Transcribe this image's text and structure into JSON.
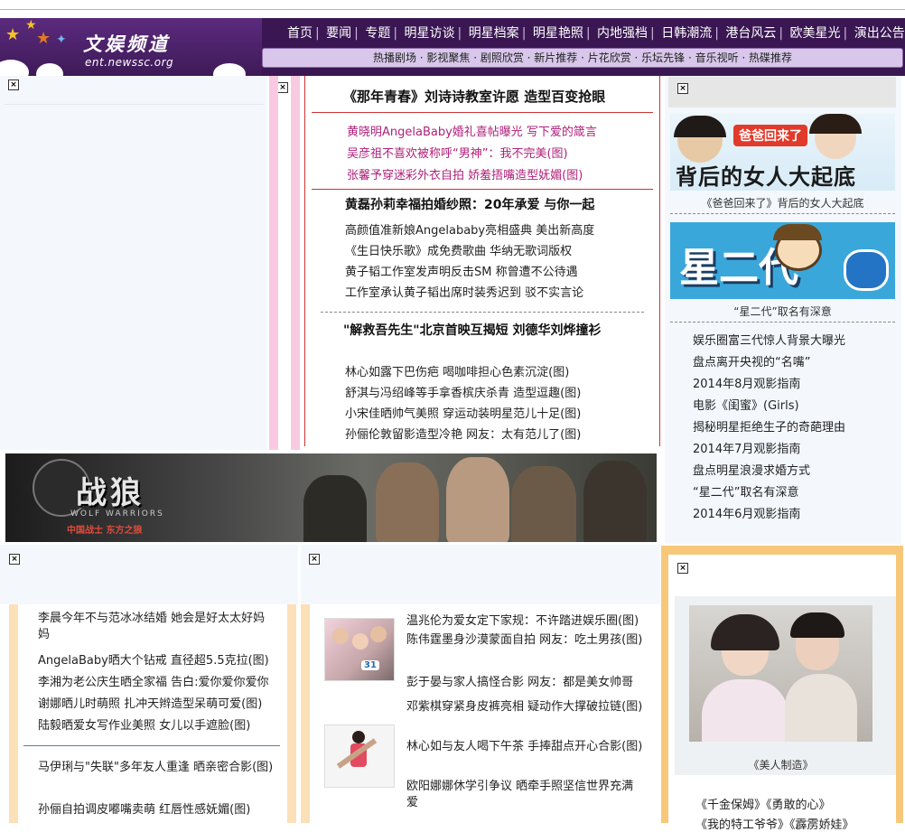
{
  "header": {
    "logo_title": "文娱频道",
    "logo_url": "ent.newssc.org",
    "nav_main": [
      "首页",
      "要闻",
      "专题",
      "明星访谈",
      "明星档案",
      "明星艳照",
      "内地强档",
      "日韩潮流",
      "港台风云",
      "欧美星光",
      "演出公告"
    ],
    "nav_sub": "热播剧场 · 影视聚焦 · 剧照欣赏 · 新片推荐 · 片花欣赏 · 乐坛先锋 · 音乐视听 · 热碟推荐"
  },
  "center": {
    "headline1": "《那年青春》刘诗诗教室许愿 造型百变抢眼",
    "pink_links": [
      "黄晓明AngelaBaby婚礼喜帖曝光 写下爱的箴言",
      "吴彦祖不喜欢被称呼“男神”：我不完美(图)",
      "张馨予穿迷彩外衣自拍 娇羞捂嘴造型妩媚(图)"
    ],
    "headline2": "黄磊孙莉幸福拍婚纱照：20年承爱 与你一起",
    "links2": [
      "高颜值准新娘Angelababy亮相盛典 美出新高度",
      "《生日快乐歌》成免费歌曲 华纳无歌词版权",
      "黄子韬工作室发声明反击SM 称曾遭不公待遇",
      "工作室承认黄子韬出席时装秀迟到 驳不实言论"
    ],
    "headline3": "\"解救吾先生\"北京首映互揭短 刘德华刘烨撞衫",
    "links3": [
      "林心如露下巴伤疤 喝咖啡担心色素沉淀(图)",
      "舒淇与冯绍峰等手拿香槟庆杀青 造型逗趣(图)",
      "小宋佳晒帅气美照 穿运动装明星范儿十足(图)",
      "孙俪伦敦留影造型冷艳 网友：太有范儿了(图)"
    ]
  },
  "right": {
    "promo1_banner": "爸爸回来了",
    "promo1_art": "背后的女人大起底",
    "promo1_caption": "《爸爸回来了》背后的女人大起底",
    "promo2_art": "星二代",
    "promo2_caption": "“星二代”取名有深意",
    "links": [
      "娱乐圈富三代惊人背景大曝光",
      "盘点离开央视的“名嘴”",
      "2014年8月观影指南",
      "电影《闺蜜》(Girls)",
      "揭秘明星拒绝生子的奇葩理由",
      "2014年7月观影指南",
      "盘点明星浪漫求婚方式",
      "“星二代”取名有深意",
      "2014年6月观影指南"
    ]
  },
  "banner": {
    "title": "战狼",
    "subtitle": "中国战士 东方之狼",
    "title_en": "WOLF WARRIORS"
  },
  "bottom_left": {
    "links1": [
      "李晨今年不与范冰冰结婚 她会是好太太好妈妈",
      "AngelaBaby晒大个钻戒 直径超5.5克拉(图)",
      "李湘为老公庆生晒全家福 告白:爱你爱你爱你",
      "谢娜晒儿时萌照 扎冲天辫造型呆萌可爱(图)",
      "陆毅晒爱女写作业美照 女儿以手遮脸(图)"
    ],
    "links2": [
      "马伊琍与\"失联\"多年友人重逢 晒亲密合影(图)",
      "孙俪自拍调皮嘟嘴卖萌 红唇性感妩媚(图)"
    ]
  },
  "bottom_mid": {
    "links1": [
      "温兆伦为爱女定下家规：不许踏进娱乐圈(图)",
      "陈伟霆墨身沙漠蒙面自拍 网友：吃土男孩(图)",
      "彭于晏与家人搞怪合影 网友：都是美女帅哥"
    ],
    "links2": [
      "邓紫棋穿紧身皮裤亮相 疑动作大撑破拉链(图)",
      "林心如与友人喝下午茶 手捧甜点开心合影(图)",
      "欧阳娜娜休学引争议 晒牵手照坚信世界充满爱"
    ],
    "thumb1_badge": "31"
  },
  "bottom_right": {
    "caption": "《美人制造》",
    "links": [
      "《千金保姆》《勇敢的心》",
      "《我的特工爷爷》《霹雳娇娃》"
    ]
  },
  "colors": {
    "header_purple": "#3a1752",
    "sub_nav": "#d8c7ea",
    "pink_link": "#b0207a",
    "accent_red": "#cc3333",
    "border_orange": "#f7c87a"
  }
}
